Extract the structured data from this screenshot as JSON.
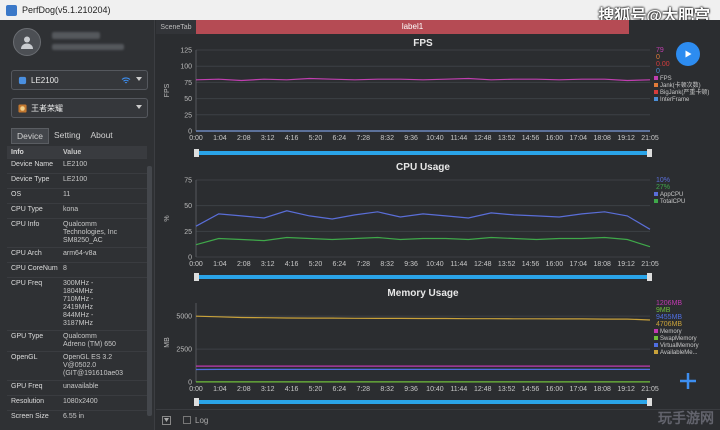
{
  "app": {
    "title": "PerfDog(v5.1.210204)",
    "watermark": "搜狐号@大肥宫"
  },
  "device_select": {
    "value": "LE2100"
  },
  "app_select": {
    "value": "王者荣耀"
  },
  "tabs": [
    "Device",
    "Setting",
    "About"
  ],
  "info_table": {
    "headers": [
      "Info",
      "Value"
    ],
    "rows": [
      [
        "Device Name",
        "LE2100"
      ],
      [
        "Device Type",
        "LE2100"
      ],
      [
        "OS",
        "11"
      ],
      [
        "CPU Type",
        "kona"
      ],
      [
        "CPU Info",
        "Qualcomm\nTechnologies, Inc\nSM8250_AC"
      ],
      [
        "CPU Arch",
        "arm64-v8a"
      ],
      [
        "CPU CoreNum",
        "8"
      ],
      [
        "CPU Freq",
        "300MHz -\n1804MHz\n710MHz -\n2419MHz\n844MHz -\n3187MHz"
      ],
      [
        "GPU Type",
        "Qualcomm\nAdreno (TM) 650"
      ],
      [
        "OpenGL",
        "OpenGL ES 3.2\nV@0502.0\n(GIT@191610ae03"
      ],
      [
        "GPU Freq",
        "unavailable"
      ],
      [
        "Resolution",
        "1080x2400"
      ],
      [
        "Screen Size",
        "6.55 in"
      ]
    ]
  },
  "scene_tab": "SceneTab",
  "label_bar": "label1",
  "x_ticks": [
    "0:00",
    "1:04",
    "2:08",
    "3:12",
    "4:16",
    "5:20",
    "6:24",
    "7:28",
    "8:32",
    "9:36",
    "10:40",
    "11:44",
    "12:48",
    "13:52",
    "14:56",
    "16:00",
    "17:04",
    "18:08",
    "19:12",
    "21:05"
  ],
  "bottom": {
    "log_label": "Log",
    "watermark": "玩手游网"
  },
  "colors": {
    "fps": "#c03fb0",
    "jank": "#e07b39",
    "bigjank": "#d43c3c",
    "interframe": "#4b8fd8",
    "appcpu": "#5a6ed8",
    "totalcpu": "#3fa84a",
    "memory": "#c039b0",
    "swap": "#6fbf3a",
    "virtual": "#4f6ee0",
    "available": "#c9a23a",
    "accent": "#2d8cf0"
  },
  "chart_data": [
    {
      "type": "line",
      "title": "FPS",
      "ylabel": "FPS",
      "ylim": [
        0,
        125
      ],
      "y_ticks": [
        0,
        25,
        50,
        75,
        100,
        125
      ],
      "legend_values": [
        "79",
        "0",
        "0.00",
        "0"
      ],
      "series": [
        {
          "name": "FPS",
          "color": "#c03fb0",
          "values": [
            79,
            80,
            78,
            80,
            79,
            81,
            80,
            79,
            80,
            80,
            79,
            80,
            81,
            79,
            80,
            80,
            79,
            80,
            80,
            78,
            79
          ]
        },
        {
          "name": "Jank(卡顿次数)",
          "color": "#e07b39",
          "values": [
            0,
            0,
            0,
            0,
            0,
            0,
            0,
            0,
            0,
            0,
            0,
            0,
            0,
            0,
            0,
            0,
            0,
            0,
            0,
            0,
            0
          ]
        },
        {
          "name": "BigJank(严重卡顿)",
          "color": "#d43c3c",
          "values": [
            0,
            0,
            0,
            0,
            0,
            0,
            0,
            0,
            0,
            0,
            0,
            0,
            0,
            0,
            0,
            0,
            0,
            0,
            0,
            0,
            0
          ]
        },
        {
          "name": "InterFrame",
          "color": "#4b8fd8",
          "values": [
            0,
            0,
            0,
            0,
            0,
            0,
            0,
            0,
            0,
            0,
            0,
            0,
            0,
            0,
            0,
            0,
            0,
            0,
            0,
            0,
            0
          ]
        }
      ]
    },
    {
      "type": "line",
      "title": "CPU Usage",
      "ylabel": "%",
      "ylim": [
        0,
        75
      ],
      "y_ticks": [
        0,
        25,
        50,
        75
      ],
      "legend_values": [
        "10%",
        "27%"
      ],
      "series": [
        {
          "name": "AppCPU",
          "color": "#5a6ed8",
          "values": [
            30,
            42,
            40,
            38,
            45,
            40,
            37,
            41,
            44,
            39,
            42,
            40,
            38,
            43,
            41,
            40,
            39,
            42,
            44,
            40,
            27
          ]
        },
        {
          "name": "TotalCPU",
          "color": "#3fa84a",
          "values": [
            12,
            18,
            17,
            16,
            19,
            18,
            17,
            18,
            19,
            17,
            18,
            18,
            17,
            19,
            18,
            17,
            18,
            18,
            19,
            17,
            10
          ]
        }
      ]
    },
    {
      "type": "line",
      "title": "Memory Usage",
      "ylabel": "MB",
      "ylim": [
        0,
        6000
      ],
      "y_ticks": [
        0,
        2500,
        5000
      ],
      "legend_values": [
        "1206MB",
        "9MB",
        "9455MB",
        "4706MB"
      ],
      "series": [
        {
          "name": "Memory",
          "color": "#c039b0",
          "values": [
            1206,
            1206,
            1206,
            1206,
            1206,
            1206,
            1206,
            1206,
            1206,
            1206,
            1206,
            1206,
            1206,
            1206,
            1206,
            1206,
            1206,
            1206,
            1206,
            1206,
            1206
          ]
        },
        {
          "name": "SwapMemory",
          "color": "#6fbf3a",
          "values": [
            9,
            9,
            9,
            9,
            9,
            9,
            9,
            9,
            9,
            9,
            9,
            9,
            9,
            9,
            9,
            9,
            9,
            9,
            9,
            9,
            9
          ]
        },
        {
          "name": "VirtualMemory",
          "color": "#4f6ee0",
          "values": [
            950,
            960,
            960,
            960,
            960,
            960,
            960,
            960,
            960,
            960,
            960,
            960,
            960,
            960,
            960,
            960,
            960,
            960,
            960,
            960,
            960
          ]
        },
        {
          "name": "AvailableMe...",
          "color": "#c9a23a",
          "values": [
            5000,
            4950,
            4900,
            4880,
            4860,
            4850,
            4850,
            4840,
            4830,
            4830,
            4820,
            4820,
            4810,
            4810,
            4800,
            4800,
            4790,
            4790,
            4780,
            4780,
            4706
          ]
        }
      ]
    }
  ]
}
